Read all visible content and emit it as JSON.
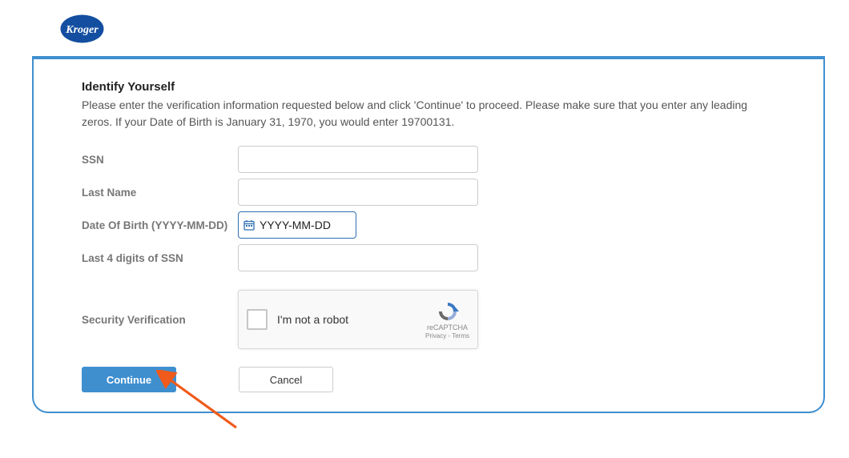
{
  "brand": {
    "name": "Kroger"
  },
  "heading": "Identify Yourself",
  "subtext": "Please enter the verification information requested below and click 'Continue' to proceed. Please make sure that you enter any leading zeros. If your Date of Birth is January 31, 1970, you would enter 19700131.",
  "fields": {
    "ssn": {
      "label": "SSN",
      "value": ""
    },
    "last_name": {
      "label": "Last Name",
      "value": ""
    },
    "dob": {
      "label": "Date Of Birth (YYYY-MM-DD)",
      "placeholder": "YYYY-MM-DD",
      "value": ""
    },
    "ssn_last4": {
      "label": "Last 4 digits of SSN",
      "value": ""
    }
  },
  "captcha": {
    "label": "Security Verification",
    "text": "I'm not a robot",
    "brand": "reCAPTCHA",
    "links": "Privacy - Terms"
  },
  "buttons": {
    "continue": "Continue",
    "cancel": "Cancel"
  },
  "colors": {
    "accent": "#3f8fcf",
    "arrow": "#f05a1a"
  }
}
